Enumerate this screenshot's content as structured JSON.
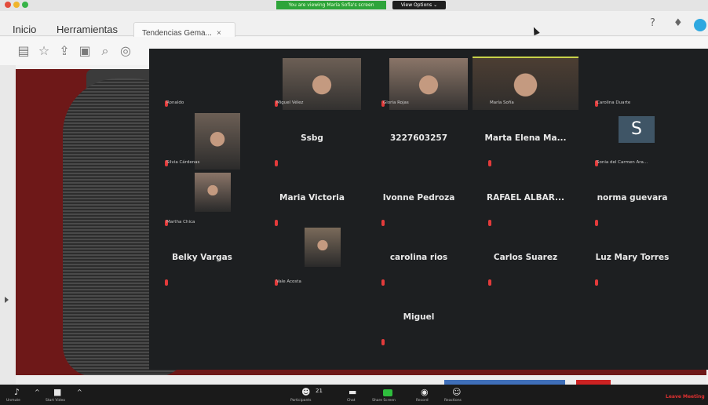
{
  "app": {
    "share_banner": "You are viewing María Sofía's screen",
    "view_options": "View Options ⌄"
  },
  "menu": {
    "inicio": "Inicio",
    "herramientas": "Herramientas",
    "tab_label": "Tendencias Gema...",
    "tab_close": "×"
  },
  "participants": {
    "rows": [
      [
        {
          "name": "",
          "label": "Ronaldo",
          "video": false,
          "mic": true
        },
        {
          "name": "",
          "label": "Miguel Vélez",
          "video": true,
          "mic": true
        },
        {
          "name": "",
          "label": "Gloria Rojas",
          "video": true,
          "mic": true
        },
        {
          "name": "",
          "label": "María Sofía",
          "video": true,
          "mic": false,
          "highlight": true
        },
        {
          "name": "",
          "label": "Carolina Duarte",
          "video": false,
          "mic": true
        }
      ],
      [
        {
          "name": "",
          "label": "Silvia Cárdenas",
          "video": true,
          "mic": true
        },
        {
          "name": "Ssbg",
          "label": "",
          "video": false,
          "mic": true
        },
        {
          "name": "3227603257",
          "label": "",
          "video": false,
          "mic": false
        },
        {
          "name": "Marta Elena Ma...",
          "label": "",
          "video": false,
          "mic": true
        },
        {
          "name": "",
          "label": "Sonia del Carmen Ara...",
          "video": false,
          "mic": true,
          "avatar": "S"
        }
      ],
      [
        {
          "name": "",
          "label": "Martha Chica",
          "video": true,
          "mic": true
        },
        {
          "name": "Maria Victoria",
          "label": "",
          "video": false,
          "mic": true
        },
        {
          "name": "Ivonne Pedroza",
          "label": "",
          "video": false,
          "mic": true
        },
        {
          "name": "RAFAEL ALBAR...",
          "label": "",
          "video": false,
          "mic": true
        },
        {
          "name": "norma guevara",
          "label": "",
          "video": false,
          "mic": true
        }
      ],
      [
        {
          "name": "Belky Vargas",
          "label": "",
          "video": false,
          "mic": true
        },
        {
          "name": "",
          "label": "Vale Acosta",
          "video": true,
          "mic": true
        },
        {
          "name": "carolina rios",
          "label": "",
          "video": false,
          "mic": true
        },
        {
          "name": "Carlos Suarez",
          "label": "",
          "video": false,
          "mic": true
        },
        {
          "name": "Luz Mary Torres",
          "label": "",
          "video": false,
          "mic": true
        }
      ],
      [
        {
          "name": "",
          "label": "",
          "video": false,
          "mic": false
        },
        {
          "name": "",
          "label": "",
          "video": false,
          "mic": false
        },
        {
          "name": "Miguel",
          "label": "",
          "video": false,
          "mic": true
        },
        {
          "name": "",
          "label": "",
          "video": false,
          "mic": false
        },
        {
          "name": "",
          "label": "",
          "video": false,
          "mic": false
        }
      ]
    ]
  },
  "controls": {
    "mute": "Unmute",
    "video": "Start Video",
    "participants_count": "21",
    "participants": "Participants",
    "chat": "Chat",
    "share": "Share Screen",
    "record": "Record",
    "reactions": "Reactions",
    "leave": "Leave Meeting"
  },
  "colors": {
    "gallery_bg": "#1d1f21",
    "banner_green": "#2ea43a",
    "speaker_highlight": "#c8d24a",
    "mic_muted": "#e33b3b",
    "leave_red": "#e03131"
  }
}
